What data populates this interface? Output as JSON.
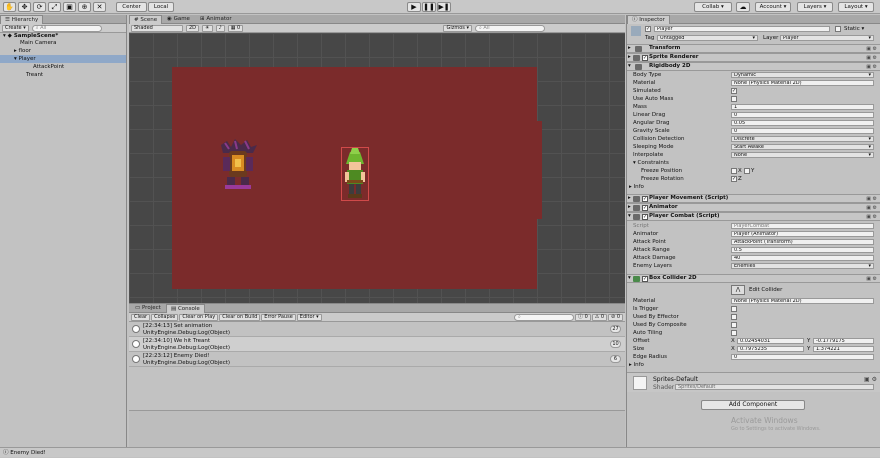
{
  "toolbar": {
    "center_label": "Center",
    "local_label": "Local",
    "collab_label": "Collab ▾",
    "account_label": "Account ▾",
    "layers_label": "Layers ▾",
    "layout_label": "Layout ▾"
  },
  "hierarchy": {
    "tab_label": "Hierarchy",
    "create_label": "Create ▾",
    "search_placeholder": "All",
    "items": [
      "SampleScene*",
      "Main Camera",
      "floor",
      "Player",
      "AttackPoint",
      "Treant"
    ]
  },
  "scene": {
    "tabs": [
      "Scene",
      "Game",
      "Animator"
    ],
    "shading_mode": "Shaded",
    "mode_2d": "2D",
    "fx_count": "0",
    "gizmos_label": "Gizmos ▾",
    "search_placeholder": "All"
  },
  "console": {
    "tabs": [
      "Project",
      "Console"
    ],
    "buttons": [
      "Clear",
      "Collapse",
      "Clear on Play",
      "Clear on Build",
      "Error Pause",
      "Editor ▾"
    ],
    "counts": {
      "info": "0",
      "warnings": "0",
      "errors": "0"
    },
    "logs": [
      {
        "line1": "[22:34:13] Set animation",
        "line2": "UnityEngine.Debug:Log(Object)",
        "count": "27"
      },
      {
        "line1": "[22:34:10] We hit Treant",
        "line2": "UnityEngine.Debug:Log(Object)",
        "count": "10"
      },
      {
        "line1": "[22:23:12] Enemy Died!",
        "line2": "UnityEngine.Debug:Log(Object)",
        "count": "6"
      }
    ]
  },
  "inspector": {
    "tab_label": "Inspector",
    "object_name": "Player",
    "static_label": "Static ▾",
    "tag_label": "Tag",
    "tag_value": "Untagged",
    "layer_label": "Layer",
    "layer_value": "Player",
    "components": {
      "transform": "Transform",
      "sprite_renderer": "Sprite Renderer",
      "rigidbody": "Rigidbody 2D",
      "player_movement": "Player Movement (Script)",
      "animator": "Animator",
      "player_combat": "Player Combat (Script)",
      "box_collider": "Box Collider 2D"
    },
    "rigidbody": {
      "body_type": {
        "label": "Body Type",
        "value": "Dynamic"
      },
      "material": {
        "label": "Material",
        "value": "None (Physics Material 2D)"
      },
      "simulated": {
        "label": "Simulated",
        "value": "✓"
      },
      "use_auto_mass": {
        "label": "Use Auto Mass",
        "value": ""
      },
      "mass": {
        "label": "Mass",
        "value": "1"
      },
      "linear_drag": {
        "label": "Linear Drag",
        "value": "0"
      },
      "angular_drag": {
        "label": "Angular Drag",
        "value": "0.05"
      },
      "gravity_scale": {
        "label": "Gravity Scale",
        "value": "0"
      },
      "collision_detection": {
        "label": "Collision Detection",
        "value": "Discrete"
      },
      "sleeping_mode": {
        "label": "Sleeping Mode",
        "value": "Start Awake"
      },
      "interpolate": {
        "label": "Interpolate",
        "value": "None"
      },
      "constraints": "Constraints",
      "freeze_position": {
        "label": "Freeze Position",
        "x": "X",
        "y": "Y"
      },
      "freeze_rotation": {
        "label": "Freeze Rotation",
        "z": "Z"
      },
      "info": "Info"
    },
    "combat": {
      "script": {
        "label": "Script",
        "value": "PlayerCombat"
      },
      "animator": {
        "label": "Animator",
        "value": "Player (Animator)"
      },
      "attack_point": {
        "label": "Attack Point",
        "value": "AttackPoint (Transform)"
      },
      "attack_range": {
        "label": "Attack Range",
        "value": "0.5"
      },
      "attack_damage": {
        "label": "Attack Damage",
        "value": "40"
      },
      "enemy_layers": {
        "label": "Enemy Layers",
        "value": "Enemies"
      }
    },
    "collider": {
      "edit_label": "Edit Collider",
      "material": {
        "label": "Material",
        "value": "None (Physics Material 2D)"
      },
      "is_trigger": {
        "label": "Is Trigger"
      },
      "used_by_effector": {
        "label": "Used By Effector"
      },
      "used_by_composite": {
        "label": "Used By Composite"
      },
      "auto_tiling": {
        "label": "Auto Tiling"
      },
      "offset": {
        "label": "Offset",
        "x": "0.02454031",
        "y": "-0.1779175"
      },
      "size": {
        "label": "Size",
        "x": "0.7975235",
        "y": "1.374221"
      },
      "edge_radius": {
        "label": "Edge Radius",
        "value": "0"
      },
      "info": "Info"
    },
    "material": {
      "name": "Sprites-Default",
      "shader_label": "Shader",
      "shader_value": "Sprites/Default"
    },
    "add_component_label": "Add Component",
    "watermark_title": "Activate Windows",
    "watermark_sub": "Go to Settings to activate Windows."
  },
  "status": {
    "message": "Enemy Died!"
  }
}
